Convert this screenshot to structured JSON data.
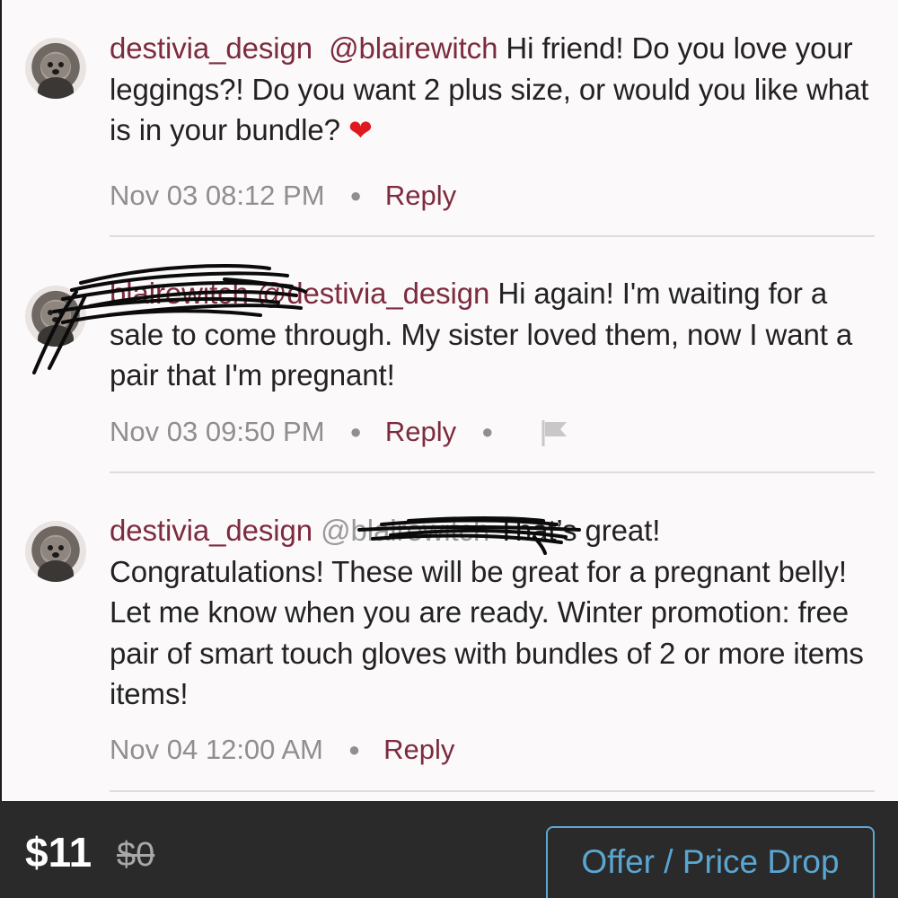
{
  "comments": [
    {
      "user": "destivia_design",
      "mention": "@blairewitch",
      "text": "Hi friend! Do you love your leggings?! Do you want 2 plus size, or would you like what is in your bundle?",
      "emoji": "❤",
      "time": "Nov 03 08:12 PM",
      "reply_label": "Reply"
    },
    {
      "user": "blairewitch",
      "mention": "@destivia_design",
      "text": "Hi again! I'm waiting for a sale to come through. My sister loved them, now I want a pair that I'm pregnant!",
      "time": "Nov 03 09:50 PM",
      "reply_label": "Reply",
      "flag_icon": "flag-icon"
    },
    {
      "user": "destivia_design",
      "mention": "@blairewitch",
      "text": "That’s great! Congratulations! These will be great for a pregnant belly! Let me know when you are ready. Winter promotion: free pair of smart touch gloves with bundles of 2 or more items items!",
      "time": "Nov 04 12:00 AM",
      "reply_label": "Reply"
    }
  ],
  "footer": {
    "price": "$11",
    "original_price": "$0",
    "offer_button": "Offer / Price Drop"
  },
  "colors": {
    "username": "#7d2b3e",
    "meta": "#8f8f8f",
    "footer_bg": "#2a2a2a",
    "offer_button": "#5aa6d2",
    "heart": "#e0191f"
  }
}
